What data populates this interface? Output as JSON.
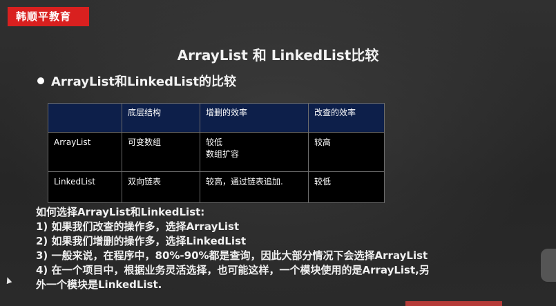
{
  "brand": "韩顺平教育",
  "title": "ArrayList 和 LinkedList比较",
  "bullet": "ArrayList和LinkedList的比较",
  "table": {
    "headers": [
      "",
      "底层结构",
      "增删的效率",
      "改查的效率"
    ],
    "rows": [
      [
        "ArrayList",
        "可变数组",
        "较低",
        "较高"
      ],
      [
        "LinkedList",
        "双向链表",
        "较高，通过链表追加.",
        "较低"
      ]
    ],
    "row0_extra": "数组扩容"
  },
  "notes": [
    "如何选择ArrayList和LinkedList:",
    "1) 如果我们改查的操作多，选择ArrayList",
    "2) 如果我们增删的操作多，选择LinkedList",
    "3) 一般来说，在程序中，80%-90%都是查询，因此大部分情况下会选择ArrayList",
    "4) 在一个项目中，根据业务灵活选择，也可能这样，一个模块使用的是ArrayList,另",
    "外一个模块是LinkedList."
  ]
}
